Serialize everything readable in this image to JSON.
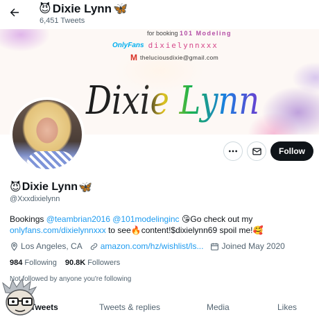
{
  "header": {
    "back_icon": "arrow-left-icon",
    "title": "Dixie Lynn",
    "title_prefix_emoji": "smiling-imp-emoji",
    "title_suffix_emoji": "butterfly-emoji",
    "tweet_count": "6,451 Tweets"
  },
  "banner": {
    "booking_prefix": "for booking",
    "booking_agency": "101 Modeling",
    "onlyfans_logo": "OnlyFans",
    "onlyfans_handle": "dixielynnxxx",
    "email": "theluciousdixie@gmail.com",
    "script_text": "Dixie Lynn"
  },
  "actions": {
    "more_icon": "more-dots-icon",
    "message_icon": "envelope-icon",
    "follow_label": "Follow"
  },
  "profile": {
    "name": "Dixie Lynn",
    "handle": "@Xxxdixielynn",
    "bio": {
      "p1": "Bookings ",
      "mention1": "@teambrian2016",
      "p2": " ",
      "mention2": "@101modelinginc",
      "p3": " 😘Go check out my",
      "link": "onlyfans.com/dixielynnxxx",
      "p4": " to see🔥content!$dixielynn69 spoil me!🥰"
    },
    "location": "Los Angeles, CA",
    "url": "amazon.com/hz/wishlist/ls...",
    "joined": "Joined May 2020",
    "following_count": "984",
    "following_label": "Following",
    "followers_count": "90.8K",
    "followers_label": "Followers",
    "not_followed": "Not followed by anyone you're following"
  },
  "tabs": [
    {
      "label": "Tweets"
    },
    {
      "label": "Tweets & replies"
    },
    {
      "label": "Media"
    },
    {
      "label": "Likes"
    }
  ],
  "colors": {
    "accent": "#1d9bf0",
    "follow_bg": "#0f1419",
    "muted": "#536471"
  }
}
